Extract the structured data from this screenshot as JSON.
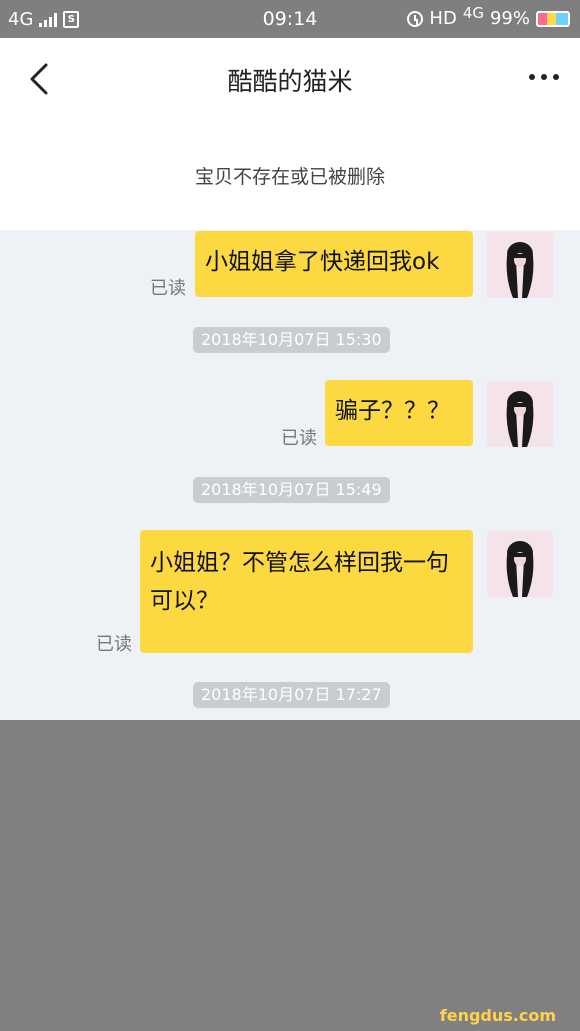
{
  "statusbar": {
    "network_left": "4G",
    "time": "09:14",
    "hd": "HD",
    "network_right": "4G",
    "battery": "99%"
  },
  "header": {
    "title": "酷酷的猫米"
  },
  "notice": "宝贝不存在或已被删除",
  "messages": [
    {
      "text": "小姐姐拿了快递回我ok",
      "status": "已读"
    },
    {
      "timestamp": "2018年10月07日 15:30"
    },
    {
      "text": "骗子？？？",
      "status": "已读"
    },
    {
      "timestamp": "2018年10月07日 15:49"
    },
    {
      "text": "小姐姐？不管怎么样回我一句可以？",
      "status": "已读"
    },
    {
      "timestamp": "2018年10月07日 17:27"
    }
  ],
  "watermark": "fengdus.com",
  "colors": {
    "bubble": "#fcd941",
    "chat_bg": "#eef1f6",
    "timestamp_bg": "#c9ccd0"
  },
  "icons": [
    "back-arrow-icon",
    "more-dots-icon",
    "signal-icon",
    "sim-icon",
    "alarm-icon",
    "battery-icon"
  ]
}
